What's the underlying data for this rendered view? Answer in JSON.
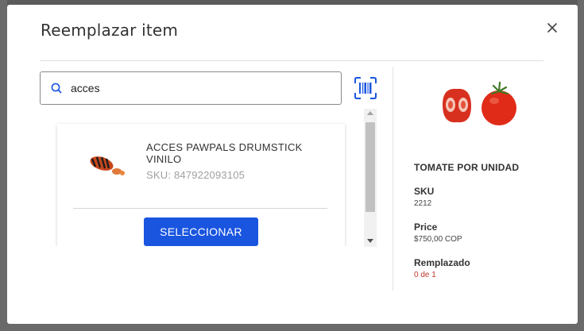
{
  "modal": {
    "title": "Reemplazar item"
  },
  "search": {
    "value": "acces",
    "placeholder": ""
  },
  "results": [
    {
      "name": "ACCES PAWPALS DRUMSTICK VINILO",
      "sku_label": "SKU: 847922093105",
      "action_label": "SELECCIONAR"
    }
  ],
  "current_item": {
    "name": "TOMATE POR UNIDAD",
    "sku_label": "SKU",
    "sku_value": "2212",
    "price_label": "Price",
    "price_value": "$750,00 COP",
    "replaced_label": "Remplazado",
    "replaced_value": "0 de 1"
  },
  "colors": {
    "primary": "#1a55e0",
    "alert": "#c0392b",
    "barcode_icon": "#1a55e0"
  },
  "icons": [
    "close-icon",
    "search-icon",
    "barcode-scan-icon",
    "product-thumbnail",
    "tomato-image"
  ]
}
